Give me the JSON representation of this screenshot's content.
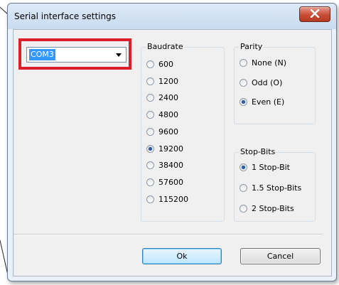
{
  "dialog": {
    "title": "Serial interface settings"
  },
  "port": {
    "selected": "COM3"
  },
  "baudrate": {
    "label": "Baudrate",
    "selected": "19200",
    "options": [
      "600",
      "1200",
      "2400",
      "4800",
      "9600",
      "19200",
      "38400",
      "57600",
      "115200"
    ]
  },
  "parity": {
    "label": "Parity",
    "selected": "Even (E)",
    "options": [
      "None (N)",
      "Odd (O)",
      "Even (E)"
    ]
  },
  "stopbits": {
    "label": "Stop-Bits",
    "selected": "1 Stop-Bit",
    "options": [
      "1 Stop-Bit",
      "1.5 Stop-Bits",
      "2 Stop-Bits"
    ]
  },
  "buttons": {
    "ok": "Ok",
    "cancel": "Cancel"
  },
  "colors": {
    "highlight_box": "#dd1f2c",
    "close_button": "#c84d36",
    "selection": "#3399ff"
  },
  "icons": {
    "close": "close-icon",
    "dropdown": "chevron-down-icon"
  }
}
